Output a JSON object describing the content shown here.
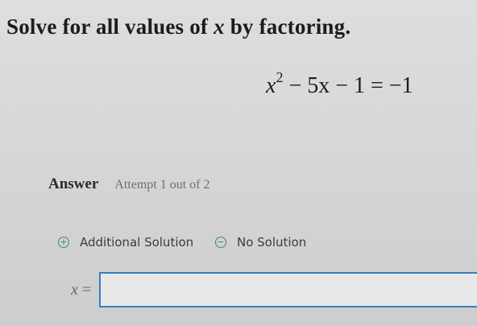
{
  "question": {
    "text_before": "Solve for all values of ",
    "variable": "x",
    "text_after": " by factoring."
  },
  "equation": {
    "base": "x",
    "exponent": "2",
    "rest": " − 5x − 1 = −1"
  },
  "answer": {
    "label": "Answer",
    "attempt": "Attempt 1 out of 2"
  },
  "options": {
    "additional": {
      "label": "Additional Solution",
      "icon": "plus-circle-icon"
    },
    "no_solution": {
      "label": "No Solution",
      "icon": "minus-circle-icon"
    }
  },
  "input": {
    "variable": "x",
    "equals": "=",
    "value": ""
  },
  "colors": {
    "accent_green": "#3f8f52",
    "input_border": "#3a7dbd"
  }
}
